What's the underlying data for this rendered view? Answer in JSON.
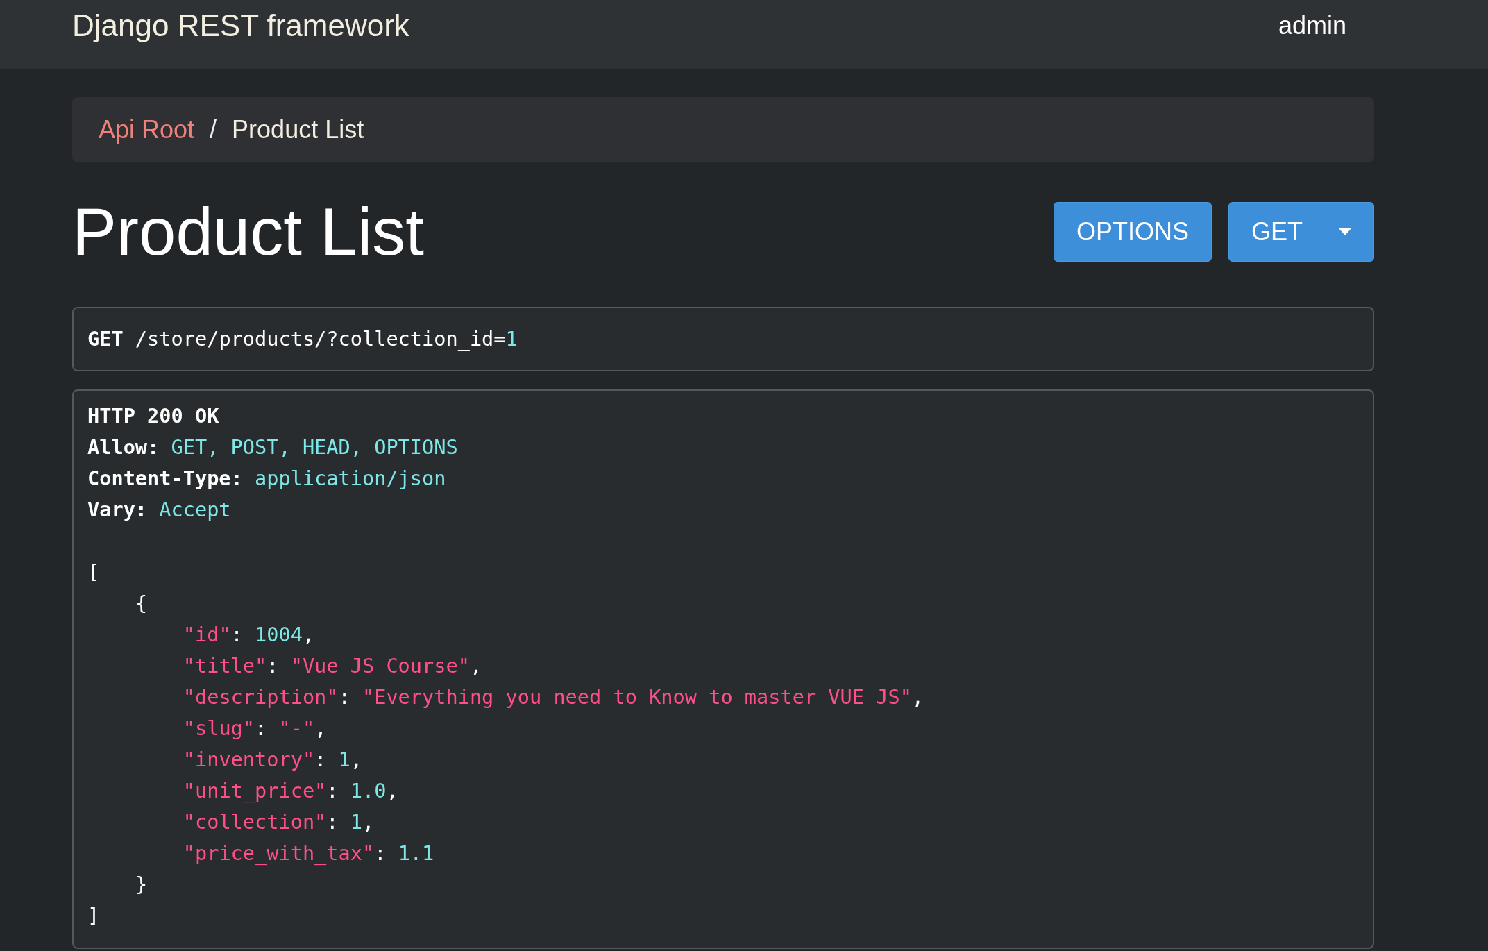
{
  "navbar": {
    "brand": "Django REST framework",
    "user": "admin"
  },
  "breadcrumb_separator": "/",
  "breadcrumb": [
    {
      "label": "Api Root",
      "link": true
    },
    {
      "label": "Product List",
      "link": false
    }
  ],
  "page_title": "Product List",
  "buttons": [
    {
      "label": "OPTIONS",
      "kind": "plain"
    },
    {
      "label": "GET",
      "kind": "split"
    }
  ],
  "request": {
    "method": "GET",
    "path": "/store/products/?collection_id=",
    "query_value": "1"
  },
  "response": {
    "status": "HTTP 200 OK",
    "headers": [
      {
        "name": "Allow:",
        "value": "GET, POST, HEAD, OPTIONS"
      },
      {
        "name": "Content-Type:",
        "value": "application/json"
      },
      {
        "name": "Vary:",
        "value": "Accept"
      }
    ],
    "body": {
      "open": "[",
      "close": "]",
      "children": [
        {
          "open": "{",
          "close": "}",
          "fields": [
            {
              "key": "\"id\"",
              "colon": ":",
              "value": "1004",
              "kind": "number",
              "trail": ","
            },
            {
              "key": "\"title\"",
              "colon": ":",
              "value": "\"Vue JS Course\"",
              "kind": "string",
              "trail": ","
            },
            {
              "key": "\"description\"",
              "colon": ":",
              "value": "\"Everything you need to Know to master VUE JS\"",
              "kind": "string",
              "trail": ","
            },
            {
              "key": "\"slug\"",
              "colon": ":",
              "value": "\"-\"",
              "kind": "string",
              "trail": ","
            },
            {
              "key": "\"inventory\"",
              "colon": ":",
              "value": "1",
              "kind": "number",
              "trail": ","
            },
            {
              "key": "\"unit_price\"",
              "colon": ":",
              "value": "1.0",
              "kind": "number",
              "trail": ","
            },
            {
              "key": "\"collection\"",
              "colon": ":",
              "value": "1",
              "kind": "number",
              "trail": ","
            },
            {
              "key": "\"price_with_tax\"",
              "colon": ":",
              "value": "1.1",
              "kind": "number"
            }
          ]
        }
      ]
    }
  }
}
